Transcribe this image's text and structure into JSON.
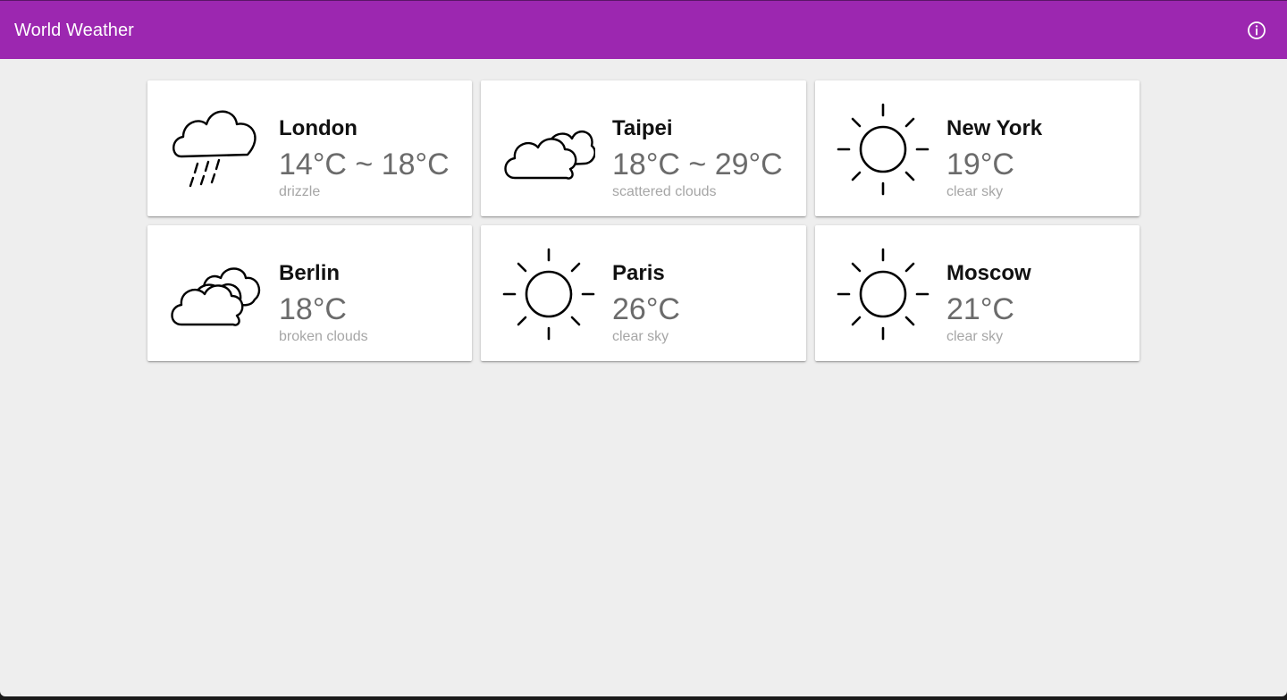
{
  "app": {
    "title": "World Weather",
    "info_icon": "info-circle-icon",
    "accent_color": "#9c27b0"
  },
  "cities": [
    {
      "name": "London",
      "temp": "14°C ~ 18°C",
      "desc": "drizzle",
      "icon": "rain-cloud-icon"
    },
    {
      "name": "Taipei",
      "temp": "18°C ~ 29°C",
      "desc": "scattered clouds",
      "icon": "cloudy-icon"
    },
    {
      "name": "New York",
      "temp": "19°C",
      "desc": "clear sky",
      "icon": "sun-icon"
    },
    {
      "name": "Berlin",
      "temp": "18°C",
      "desc": "broken clouds",
      "icon": "cloudy-icon"
    },
    {
      "name": "Paris",
      "temp": "26°C",
      "desc": "clear sky",
      "icon": "sun-icon"
    },
    {
      "name": "Moscow",
      "temp": "21°C",
      "desc": "clear sky",
      "icon": "sun-icon"
    }
  ]
}
